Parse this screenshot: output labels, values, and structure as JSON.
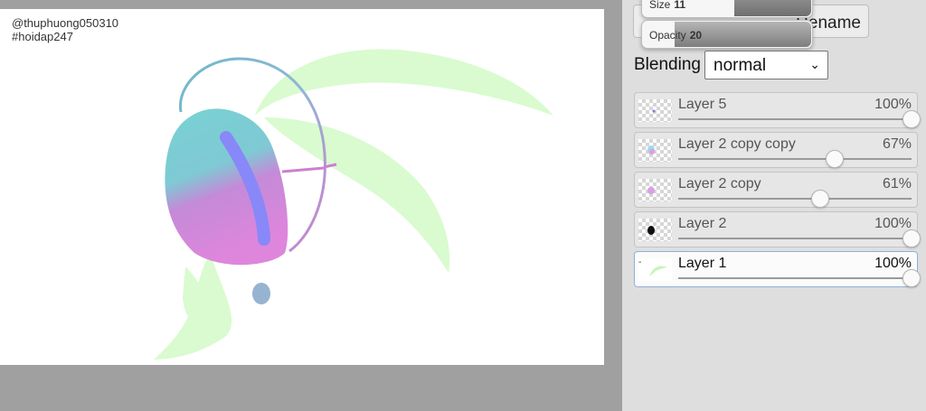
{
  "canvas": {
    "watermark_line1": "@thuphuong050310",
    "watermark_line2": "#hoidap247"
  },
  "brush_popups": {
    "size_label": "Size",
    "size_value": "11",
    "opacity_label": "Opacity",
    "opacity_value": "20"
  },
  "toolbar": {
    "rename_label": "Rename"
  },
  "blending": {
    "label": "Blending",
    "value": "normal"
  },
  "layers": [
    {
      "name": "Layer 5",
      "opacity": "100%",
      "opacity_value": 1.0,
      "selected": false,
      "thumb_icon": "tiny-purple-dot"
    },
    {
      "name": "Layer 2 copy copy",
      "opacity": "67%",
      "opacity_value": 0.67,
      "selected": false,
      "thumb_icon": "cyan-pink-blob"
    },
    {
      "name": "Layer 2 copy",
      "opacity": "61%",
      "opacity_value": 0.61,
      "selected": false,
      "thumb_icon": "pink-blob"
    },
    {
      "name": "Layer 2",
      "opacity": "100%",
      "opacity_value": 1.0,
      "selected": false,
      "thumb_icon": "black-blob"
    },
    {
      "name": "Layer 1",
      "opacity": "100%",
      "opacity_value": 1.0,
      "selected": true,
      "thumb_icon": "green-leaves"
    }
  ],
  "colors": {
    "selected_border": "#8fb0d8",
    "leaf_green": "#d9fbcf",
    "head_cyan": "#76cfd3",
    "head_pink": "#dc88dc",
    "stroke_blue": "#8888f8"
  }
}
